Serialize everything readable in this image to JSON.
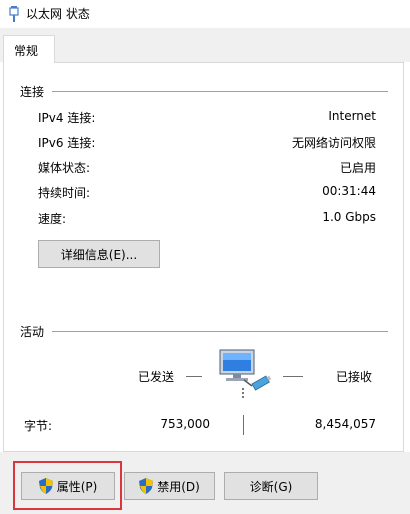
{
  "window": {
    "title": "以太网 状态"
  },
  "tabs": [
    {
      "label": "常规"
    }
  ],
  "connection": {
    "group_label": "连接",
    "rows": [
      {
        "label": "IPv4 连接:",
        "value": "Internet"
      },
      {
        "label": "IPv6 连接:",
        "value": "无网络访问权限"
      },
      {
        "label": "媒体状态:",
        "value": "已启用"
      },
      {
        "label": "持续时间:",
        "value": "00:31:44"
      },
      {
        "label": "速度:",
        "value": "1.0 Gbps"
      }
    ],
    "details_button": "详细信息(E)..."
  },
  "activity": {
    "group_label": "活动",
    "sent_label": "已发送",
    "received_label": "已接收",
    "bytes_label": "字节:",
    "bytes_sent": "753,000",
    "bytes_received": "8,454,057"
  },
  "buttons": {
    "properties": "属性(P)",
    "disable": "禁用(D)",
    "diagnose": "诊断(G)"
  },
  "colors": {
    "highlight": "#d9363e",
    "shield_blue": "#2b6cc4",
    "shield_yellow": "#f2c200"
  }
}
